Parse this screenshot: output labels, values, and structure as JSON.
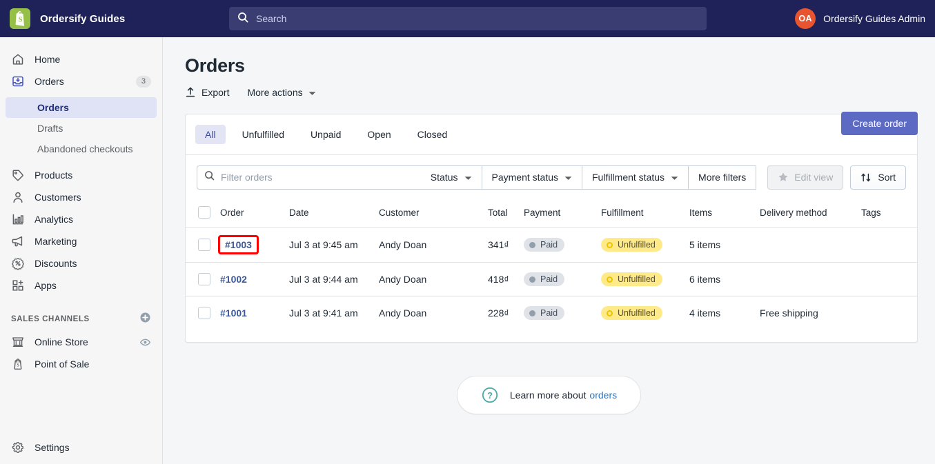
{
  "topbar": {
    "brand_name": "Ordersify Guides",
    "logo_icon": "shopify-bag-icon",
    "search": {
      "icon": "search-icon",
      "value": "",
      "placeholder": "Search"
    },
    "account": {
      "initials": "OA",
      "name": "Ordersify Guides Admin",
      "avatar_color": "#e8542f"
    }
  },
  "sidebar": {
    "items": [
      {
        "label": "Home",
        "icon": "home-icon",
        "count": ""
      },
      {
        "label": "Orders",
        "icon": "orders-inbox-icon",
        "count": "3"
      },
      {
        "label": "Products",
        "icon": "products-tag-icon",
        "count": ""
      },
      {
        "label": "Customers",
        "icon": "customers-person-icon",
        "count": ""
      },
      {
        "label": "Analytics",
        "icon": "analytics-bars-icon",
        "count": ""
      },
      {
        "label": "Marketing",
        "icon": "marketing-megaphone-icon",
        "count": ""
      },
      {
        "label": "Discounts",
        "icon": "discounts-percent-icon",
        "count": ""
      },
      {
        "label": "Apps",
        "icon": "apps-grid-plus-icon",
        "count": ""
      }
    ],
    "sub_items": [
      {
        "label": "Orders",
        "active": true
      },
      {
        "label": "Drafts",
        "active": false
      },
      {
        "label": "Abandoned checkouts",
        "active": false
      }
    ],
    "sales_channels": {
      "heading": "SALES CHANNELS",
      "add_icon": "plus-circle-icon",
      "items": [
        {
          "label": "Online Store",
          "icon": "online-store-icon",
          "trailing_icon": "eye-icon"
        },
        {
          "label": "Point of Sale",
          "icon": "point-of-sale-icon",
          "trailing_icon": ""
        }
      ]
    },
    "settings": {
      "label": "Settings",
      "icon": "gear-icon"
    }
  },
  "page": {
    "title": "Orders",
    "export_label": "Export",
    "export_icon": "upload-arrow-icon",
    "more_actions_label": "More actions",
    "more_actions_icon": "chevron-down-icon",
    "create_order_label": "Create order",
    "create_order_color": "#5c6ac4"
  },
  "tabs": [
    {
      "label": "All",
      "active": true
    },
    {
      "label": "Unfulfilled",
      "active": false
    },
    {
      "label": "Unpaid",
      "active": false
    },
    {
      "label": "Open",
      "active": false
    },
    {
      "label": "Closed",
      "active": false
    }
  ],
  "filters": {
    "search_icon": "search-icon",
    "filter_value": "",
    "filter_placeholder": "Filter orders",
    "status_label": "Status",
    "payment_status_label": "Payment status",
    "fulfillment_status_label": "Fulfillment status",
    "more_filters_label": "More filters",
    "edit_view_label": "Edit view",
    "edit_view_icon": "star-icon",
    "edit_view_disabled": true,
    "sort_label": "Sort",
    "sort_icon": "sort-arrows-icon"
  },
  "table": {
    "columns": [
      "Order",
      "Date",
      "Customer",
      "Total",
      "Payment",
      "Fulfillment",
      "Items",
      "Delivery method",
      "Tags"
    ],
    "rows": [
      {
        "order": "#1003",
        "highlighted": true,
        "date": "Jul 3 at 9:45 am",
        "customer": "Andy Doan",
        "total": "341₫",
        "payment": "Paid",
        "fulfillment": "Unfulfilled",
        "items": "5 items",
        "delivery_method": "",
        "tags": ""
      },
      {
        "order": "#1002",
        "highlighted": false,
        "date": "Jul 3 at 9:44 am",
        "customer": "Andy Doan",
        "total": "418₫",
        "payment": "Paid",
        "fulfillment": "Unfulfilled",
        "items": "6 items",
        "delivery_method": "",
        "tags": ""
      },
      {
        "order": "#1001",
        "highlighted": false,
        "date": "Jul 3 at 9:41 am",
        "customer": "Andy Doan",
        "total": "228₫",
        "payment": "Paid",
        "fulfillment": "Unfulfilled",
        "items": "4 items",
        "delivery_method": "Free shipping",
        "tags": ""
      }
    ]
  },
  "footer_help": {
    "icon": "question-mark-circle-icon",
    "text": "Learn more about",
    "link": "orders"
  },
  "colors": {
    "topbar_bg": "#1f2259",
    "accent": "#5c6ac4",
    "highlight_box": "#ff0000",
    "badge_paid_bg": "#dfe3e8",
    "badge_unfulfilled_bg": "#ffea8a",
    "link": "#3b5998"
  }
}
